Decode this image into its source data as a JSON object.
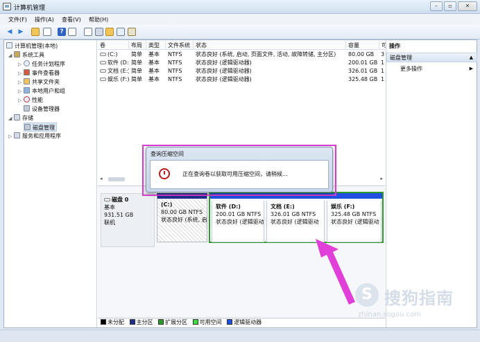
{
  "window": {
    "title": "计算机管理"
  },
  "menu": [
    "文件(F)",
    "操作(A)",
    "查看(V)",
    "帮助(H)"
  ],
  "toolbar_icons": [
    "back-icon",
    "forward-icon",
    "up-icon",
    "show-tree-icon",
    "help-icon",
    "console-icon",
    "properties-icon",
    "open-icon",
    "search-icon",
    "settings-icon"
  ],
  "tree": {
    "root": "计算机管理(本地)",
    "system_tools": "系统工具",
    "task_scheduler": "任务计划程序",
    "event_viewer": "事件查看器",
    "shared_folders": "共享文件夹",
    "local_users": "本地用户和组",
    "performance": "性能",
    "device_manager": "设备管理器",
    "storage": "存储",
    "disk_management": "磁盘管理",
    "services_apps": "服务和应用程序"
  },
  "columns": [
    "卷",
    "布局",
    "类型",
    "文件系统",
    "状态",
    "容量",
    "可"
  ],
  "volumes": [
    {
      "name": "(C:)",
      "layout": "简单",
      "type": "基本",
      "fs": "NTFS",
      "status": "状态良好 (系统, 启动, 页面文件, 活动, 故障转储, 主分区)",
      "capacity": "80.00 GB",
      "free": "3"
    },
    {
      "name": "软件 (D:)",
      "layout": "简单",
      "type": "基本",
      "fs": "NTFS",
      "status": "状态良好 (逻辑驱动器)",
      "capacity": "200.01 GB",
      "free": "1"
    },
    {
      "name": "文档 (E:)",
      "layout": "简单",
      "type": "基本",
      "fs": "NTFS",
      "status": "状态良好 (逻辑驱动器)",
      "capacity": "326.01 GB",
      "free": "1"
    },
    {
      "name": "娱乐 (F:)",
      "layout": "简单",
      "type": "基本",
      "fs": "NTFS",
      "status": "状态良好 (逻辑驱动器)",
      "capacity": "325.48 GB",
      "free": "1"
    }
  ],
  "disk": {
    "name": "磁盘 0",
    "type": "基本",
    "size": "931.51 GB",
    "state": "联机"
  },
  "partitions": [
    {
      "name": "(C:)",
      "size": "80.00 GB NTFS",
      "status": "状态良好 (系统, 启"
    },
    {
      "name": "软件  (D:)",
      "size": "200.01 GB NTFS",
      "status": "状态良好 (逻辑驱动"
    },
    {
      "name": "文档  (E:)",
      "size": "326.01 GB NTFS",
      "status": "状态良好 (逻辑驱动"
    },
    {
      "name": "娱乐  (F:)",
      "size": "325.48 GB NTFS",
      "status": "状态良好 (逻辑驱动"
    }
  ],
  "legend": [
    {
      "label": "未分配",
      "color": "#000000"
    },
    {
      "label": "主分区",
      "color": "#1d2e8c"
    },
    {
      "label": "扩展分区",
      "color": "#2c9a2c"
    },
    {
      "label": "可用空间",
      "color": "#45d845"
    },
    {
      "label": "逻辑驱动器",
      "color": "#1f4fe0"
    }
  ],
  "actions": {
    "header": "操作",
    "section": "磁盘管理",
    "more": "更多操作"
  },
  "dialog": {
    "title": "查询压缩空间",
    "message": "正在查询卷以获取可用压缩空间，请稍候..."
  },
  "watermark": {
    "text": "搜狗指南",
    "url": "zhinan.sogou.com"
  },
  "colors": {
    "highlight": "#d83cd0",
    "arrow": "#e040d8"
  }
}
